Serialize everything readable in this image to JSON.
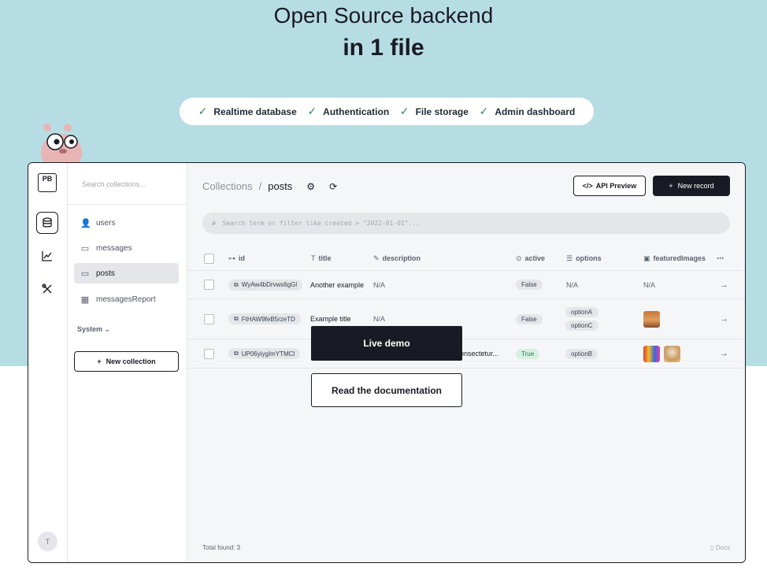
{
  "hero": {
    "title": "Open Source backend",
    "subtitle": "in 1 file",
    "features": [
      "Realtime database",
      "Authentication",
      "File storage",
      "Admin dashboard"
    ]
  },
  "rail": {
    "logo": "PB",
    "avatar": "T",
    "icons": [
      "database-icon",
      "chart-line-icon",
      "tools-icon"
    ]
  },
  "sidebar": {
    "search_placeholder": "Search collections...",
    "items": [
      {
        "label": "users",
        "icon": "users-icon"
      },
      {
        "label": "messages",
        "icon": "folder-icon"
      },
      {
        "label": "posts",
        "icon": "folder-icon",
        "active": true
      },
      {
        "label": "messagesReport",
        "icon": "table-icon"
      }
    ],
    "system_label": "System",
    "new_collection_label": "New collection"
  },
  "header": {
    "breadcrumb_root": "Collections",
    "breadcrumb_sep": "/",
    "breadcrumb_current": "posts",
    "api_preview_label": "API Preview",
    "new_record_label": "New record"
  },
  "filter": {
    "placeholder": "Search term or filter like created > \"2022-01-01\"..."
  },
  "table": {
    "columns": [
      "id",
      "title",
      "description",
      "active",
      "options",
      "featuredImages"
    ],
    "rows": [
      {
        "id": "WyAw4bDrvws6gGl",
        "title": "Another example",
        "description": "N/A",
        "active": "False",
        "options": [
          "N/A"
        ],
        "images": "N/A"
      },
      {
        "id": "FtHAW9feB5rzeTD",
        "title": "Example title",
        "description": "N/A",
        "active": "False",
        "options": [
          "optionA",
          "optionC"
        ],
        "images": ""
      },
      {
        "id": "UP06yiygImYTMCl",
        "title": "",
        "description": "onsectetur...",
        "active": "True",
        "options": [
          "optionB"
        ],
        "images": ""
      }
    ]
  },
  "footer": {
    "total": "Total found: 3",
    "docs": "Docs"
  },
  "cta": {
    "live_demo": "Live demo",
    "read_docs": "Read the documentation"
  },
  "colors": {
    "hero_bg": "#b7dde4",
    "accent_dark": "#1a1a24",
    "check_green": "#2a8c5b"
  }
}
